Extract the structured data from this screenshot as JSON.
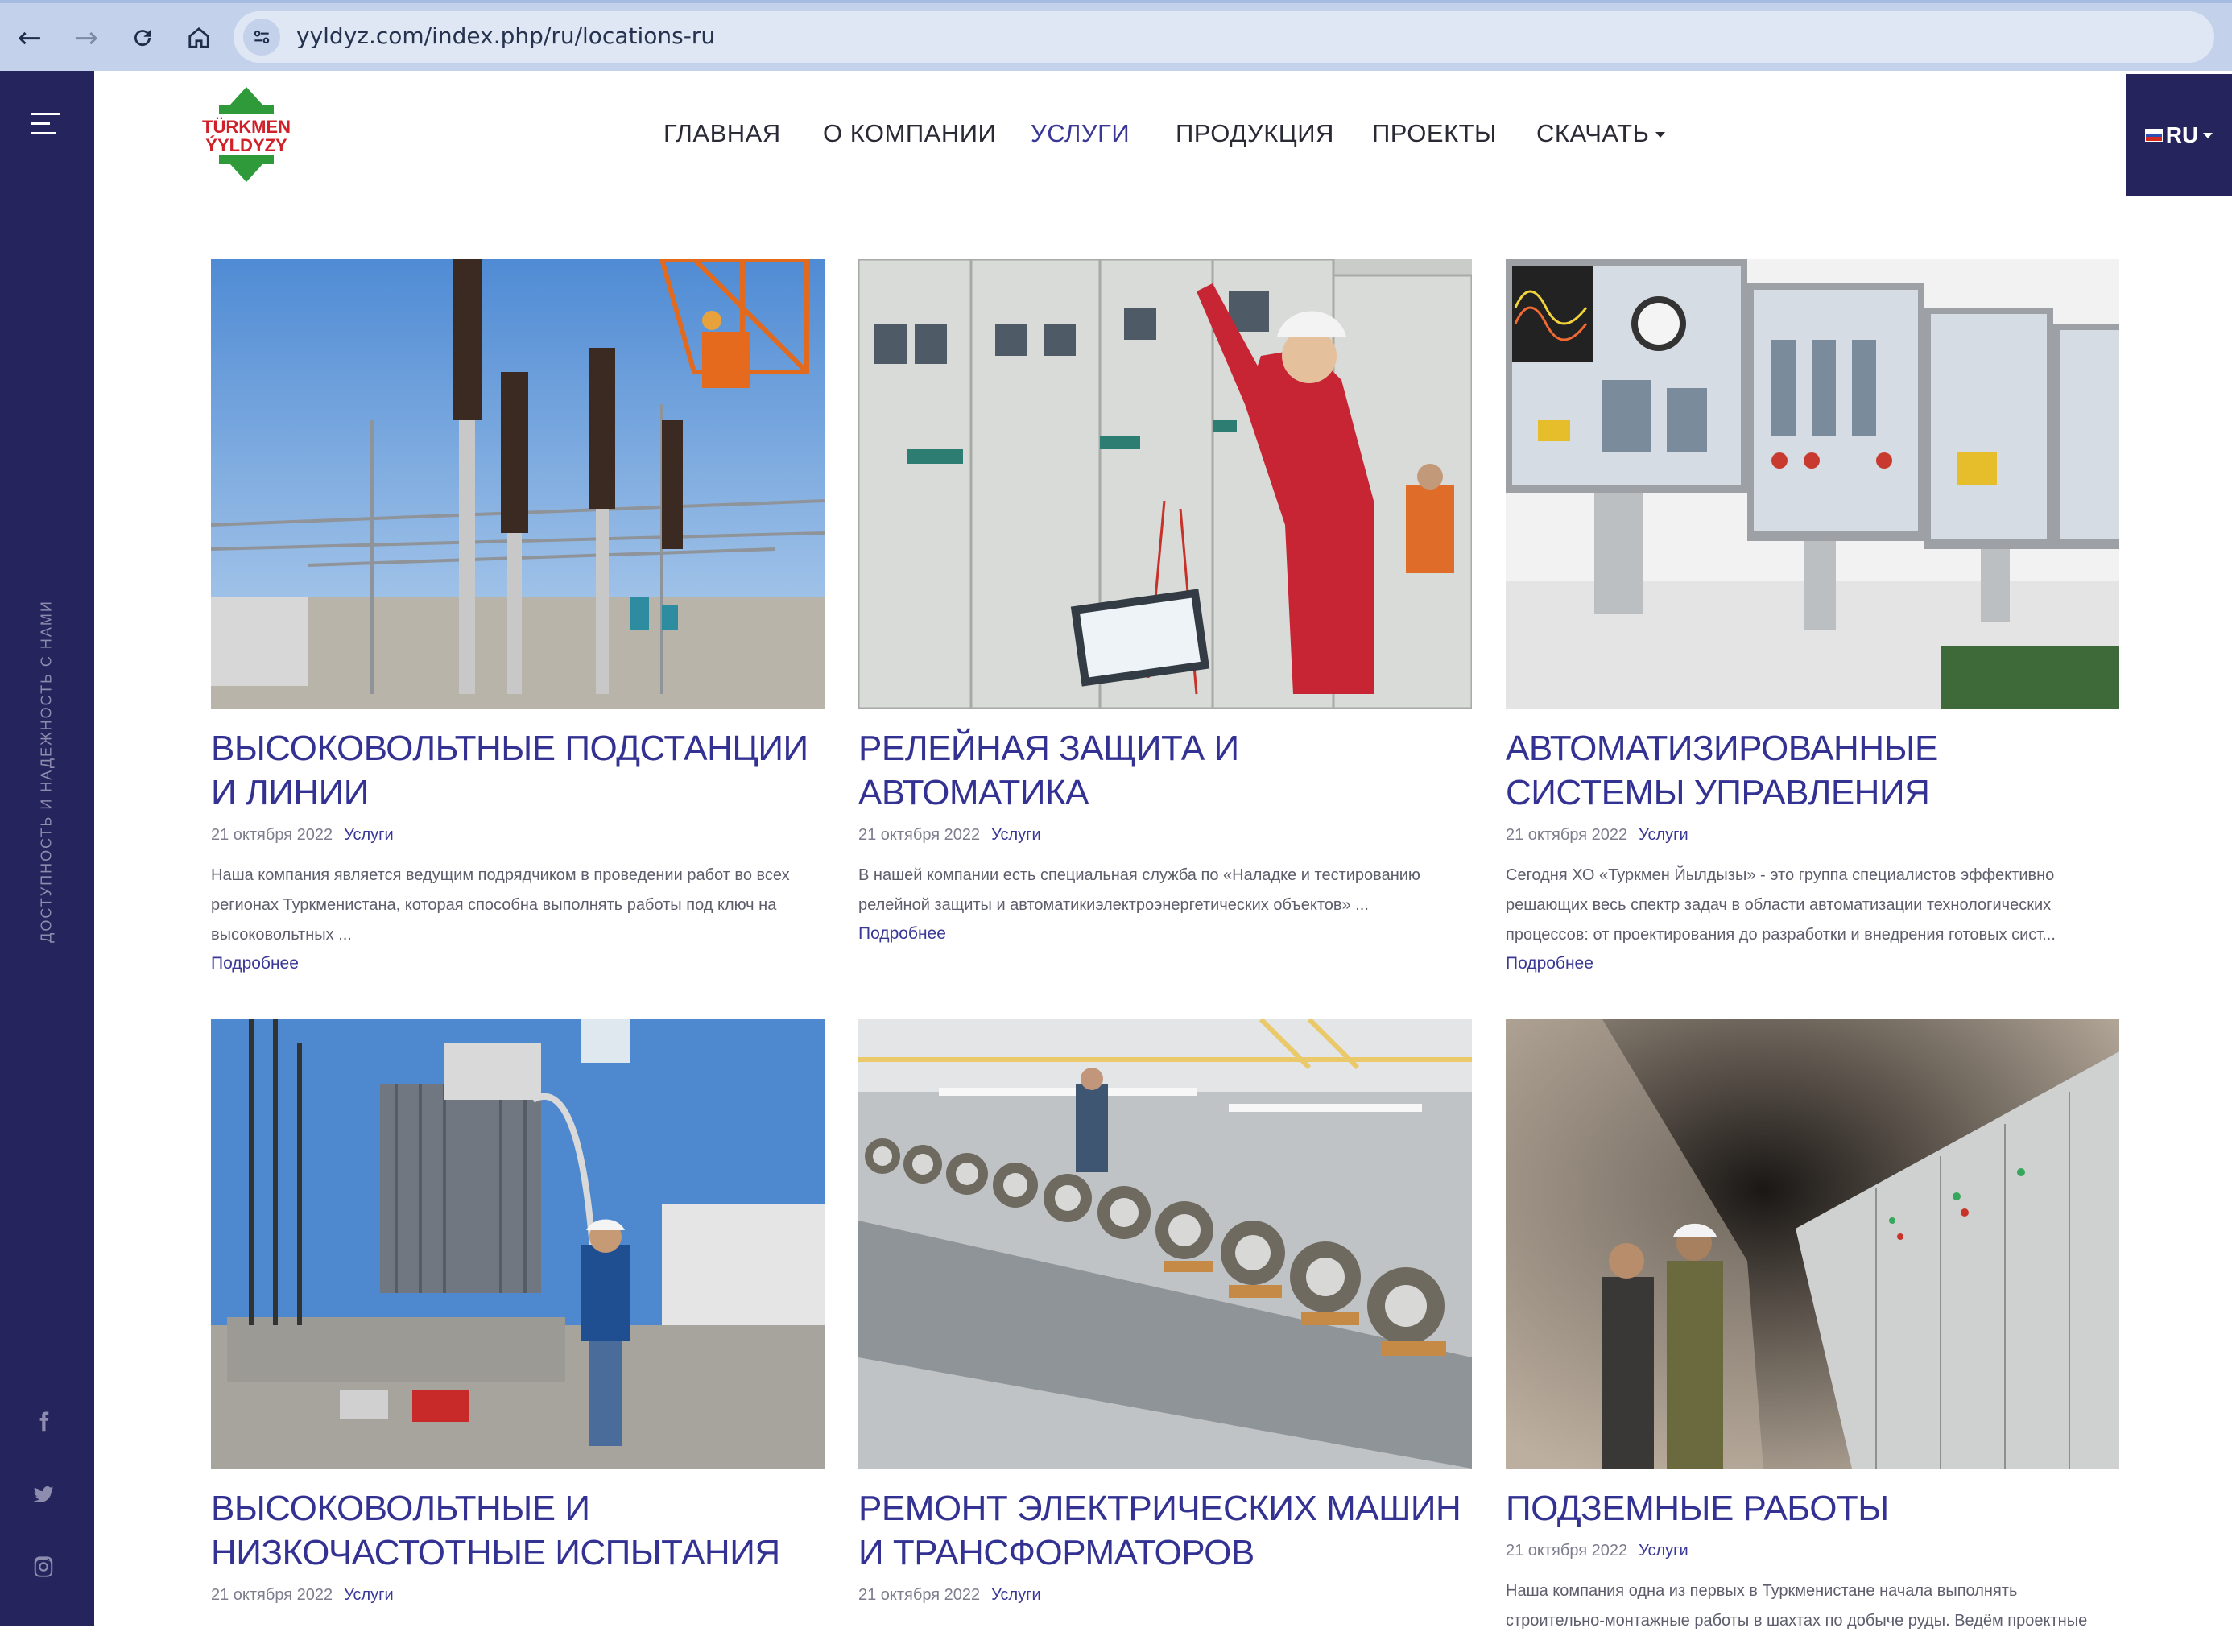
{
  "browser": {
    "url": "yyldyz.com/index.php/ru/locations-ru"
  },
  "sidebar": {
    "vertical_text": "ДОСТУПНОСТЬ И НАДЕЖНОСТЬ С НАМИ",
    "socials": [
      "facebook-icon",
      "twitter-icon",
      "instagram-icon"
    ]
  },
  "header": {
    "logo_line1": "TÜRKMEN",
    "logo_line2": "ÝYLDYZY",
    "nav": [
      "ГЛАВНАЯ",
      "О КОМПАНИИ",
      "УСЛУГИ",
      "ПРОДУКЦИЯ",
      "ПРОЕКТЫ",
      "СКАЧАТЬ"
    ],
    "active_nav": "УСЛУГИ",
    "lang": "RU"
  },
  "cards": [
    {
      "title": "ВЫСОКОВОЛЬТНЫЕ ПОДСТАНЦИИ И ЛИНИИ",
      "date": "21 октября 2022",
      "category": "Услуги",
      "excerpt": "Наша компания является ведущим подрядчиком в проведении работ во всех регионах Туркменистана, которая способна выполнять работы под ключ на высоковольтных ...",
      "more": "Подробнее"
    },
    {
      "title": "РЕЛЕЙНАЯ ЗАЩИТА И АВТОМАТИКА",
      "date": "21 октября 2022",
      "category": "Услуги",
      "excerpt": "В нашей компании есть специальная служба по «Наладке и тестированию релейной защиты и автоматикиэлектроэнергетических объектов» ...",
      "more": "Подробнее"
    },
    {
      "title": "АВТОМАТИЗИРОВАННЫЕ СИСТЕМЫ УПРАВЛЕНИЯ",
      "date": "21 октября 2022",
      "category": "Услуги",
      "excerpt": "Сегодня ХО «Туркмен Йылдызы» - это группа специалистов эффективно решающих весь спектр задач в области автоматизации технологических процессов: от проектирования до разработки и внедрения готовых сист...",
      "more": "Подробнее"
    },
    {
      "title": "ВЫСОКОВОЛЬТНЫЕ И НИЗКОЧАСТОТНЫЕ ИСПЫТАНИЯ",
      "date": "21 октября 2022",
      "category": "Услуги",
      "excerpt": "",
      "more": ""
    },
    {
      "title": "РЕМОНТ ЭЛЕКТРИЧЕСКИХ МАШИН И ТРАНСФОРМАТОРОВ",
      "date": "21 октября 2022",
      "category": "Услуги",
      "excerpt": "",
      "more": ""
    },
    {
      "title": "ПОДЗЕМНЫЕ РАБОТЫ",
      "date": "21 октября 2022",
      "category": "Услуги",
      "excerpt": "Наша компания одна из первых в Туркменистане начала выполнять строительно-монтажные работы в шахтах по добыче руды. Ведём проектные",
      "more": ""
    }
  ]
}
